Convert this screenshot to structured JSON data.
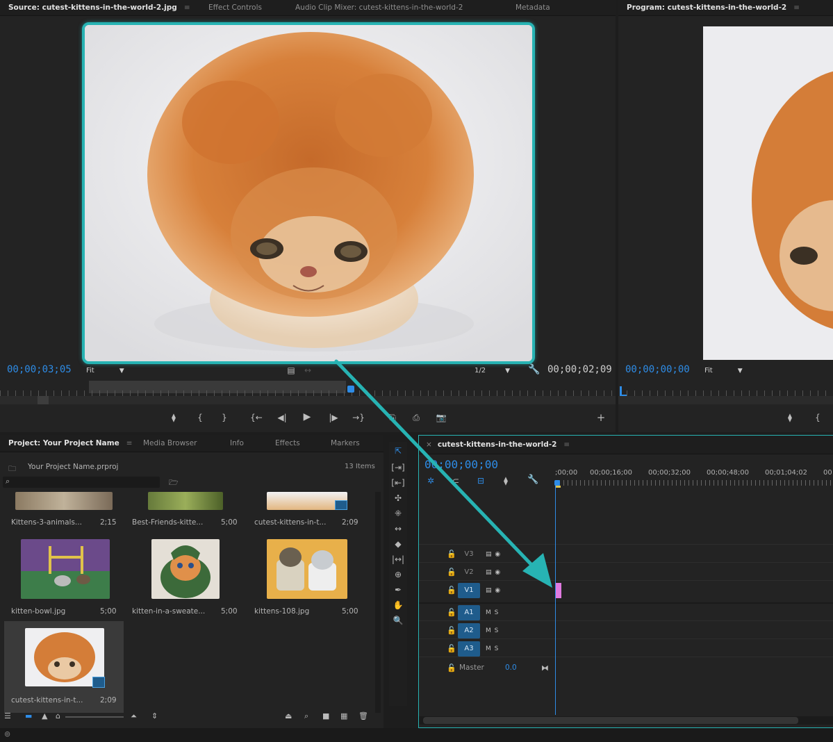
{
  "source_monitor": {
    "tabs": [
      "Source: cutest-kittens-in-the-world-2.jpg",
      "Effect Controls",
      "Audio Clip Mixer: cutest-kittens-in-the-world-2",
      "Metadata"
    ],
    "menu_glyph": "≡",
    "timecode_in": "00;00;03;05",
    "fit_label": "Fit",
    "resolution": "1/2",
    "timecode_duration": "00;00;02;09",
    "controls": [
      "⧫",
      "{",
      "}",
      "{←",
      "◀|",
      "▶",
      "|▶",
      "→}",
      "⎘",
      "⎙",
      "📷",
      "+"
    ]
  },
  "program_monitor": {
    "tab": "Program: cutest-kittens-in-the-world-2",
    "menu_glyph": "≡",
    "timecode": "00;00;00;00",
    "fit_label": "Fit",
    "controls": [
      "⧫",
      "{"
    ]
  },
  "project_panel": {
    "tabs": [
      "Project: Your Project Name",
      "Media Browser",
      "Info",
      "Effects",
      "Markers"
    ],
    "menu_glyph": "≡",
    "project_file": "Your Project Name.prproj",
    "item_count": "13 Items",
    "search_placeholder": "",
    "items": [
      {
        "name": "Kittens-3-animals...",
        "duration": "2;15"
      },
      {
        "name": "Best-Friends-kitte...",
        "duration": "5;00"
      },
      {
        "name": "cutest-kittens-in-t...",
        "duration": "2;09"
      },
      {
        "name": "kitten-bowl.jpg",
        "duration": "5;00"
      },
      {
        "name": "kitten-in-a-sweate...",
        "duration": "5;00"
      },
      {
        "name": "kittens-108.jpg",
        "duration": "5;00"
      },
      {
        "name": "cutest-kittens-in-t...",
        "duration": "2;09"
      }
    ]
  },
  "timeline": {
    "tab": "cutest-kittens-in-the-world-2",
    "close_glyph": "×",
    "menu_glyph": "≡",
    "timecode": "00;00;00;00",
    "ruler_labels": [
      ";00;00",
      "00;00;16;00",
      "00;00;32;00",
      "00;00;48;00",
      "00;01;04;02",
      "00"
    ],
    "video_tracks": [
      "V3",
      "V2",
      "V1"
    ],
    "audio_tracks": [
      "A1",
      "A2",
      "A3"
    ],
    "audio_buttons": "M  S",
    "master_label": "Master",
    "master_value": "0.0"
  },
  "colors": {
    "accent_teal": "#27b3b3",
    "timecode_blue": "#2e8ce6",
    "clip_pink": "#e07ae0",
    "track_target": "#1f5c8c"
  }
}
